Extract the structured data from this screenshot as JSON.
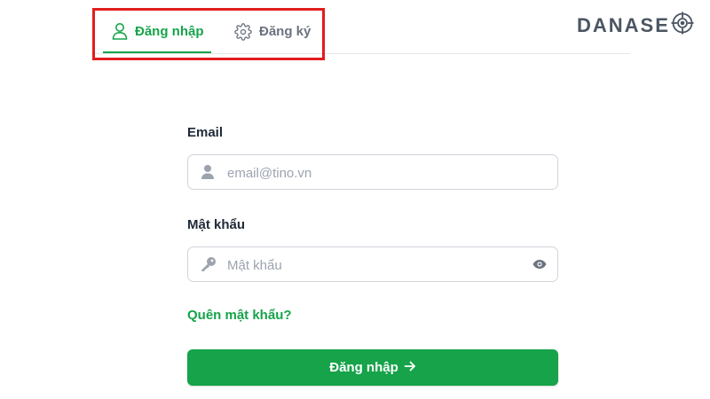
{
  "tabs": [
    {
      "label": "Đăng nhập",
      "icon": "user-icon",
      "active": true
    },
    {
      "label": "Đăng ký",
      "icon": "gear-icon",
      "active": false
    }
  ],
  "brand": {
    "text": "DANASE",
    "icon": "target-icon"
  },
  "form": {
    "email": {
      "label": "Email",
      "placeholder": "email@tino.vn",
      "icon": "user-icon"
    },
    "password": {
      "label": "Mật khẩu",
      "placeholder": "Mật khẩu",
      "icon": "key-icon",
      "toggle_icon": "eye-icon"
    },
    "forgot_link": "Quên mật khẩu?",
    "submit_label": "Đăng nhập",
    "submit_icon": "arrow-right-icon"
  },
  "colors": {
    "accent": "#16a34a",
    "highlight": "#e11d1d",
    "muted": "#6b7280"
  }
}
